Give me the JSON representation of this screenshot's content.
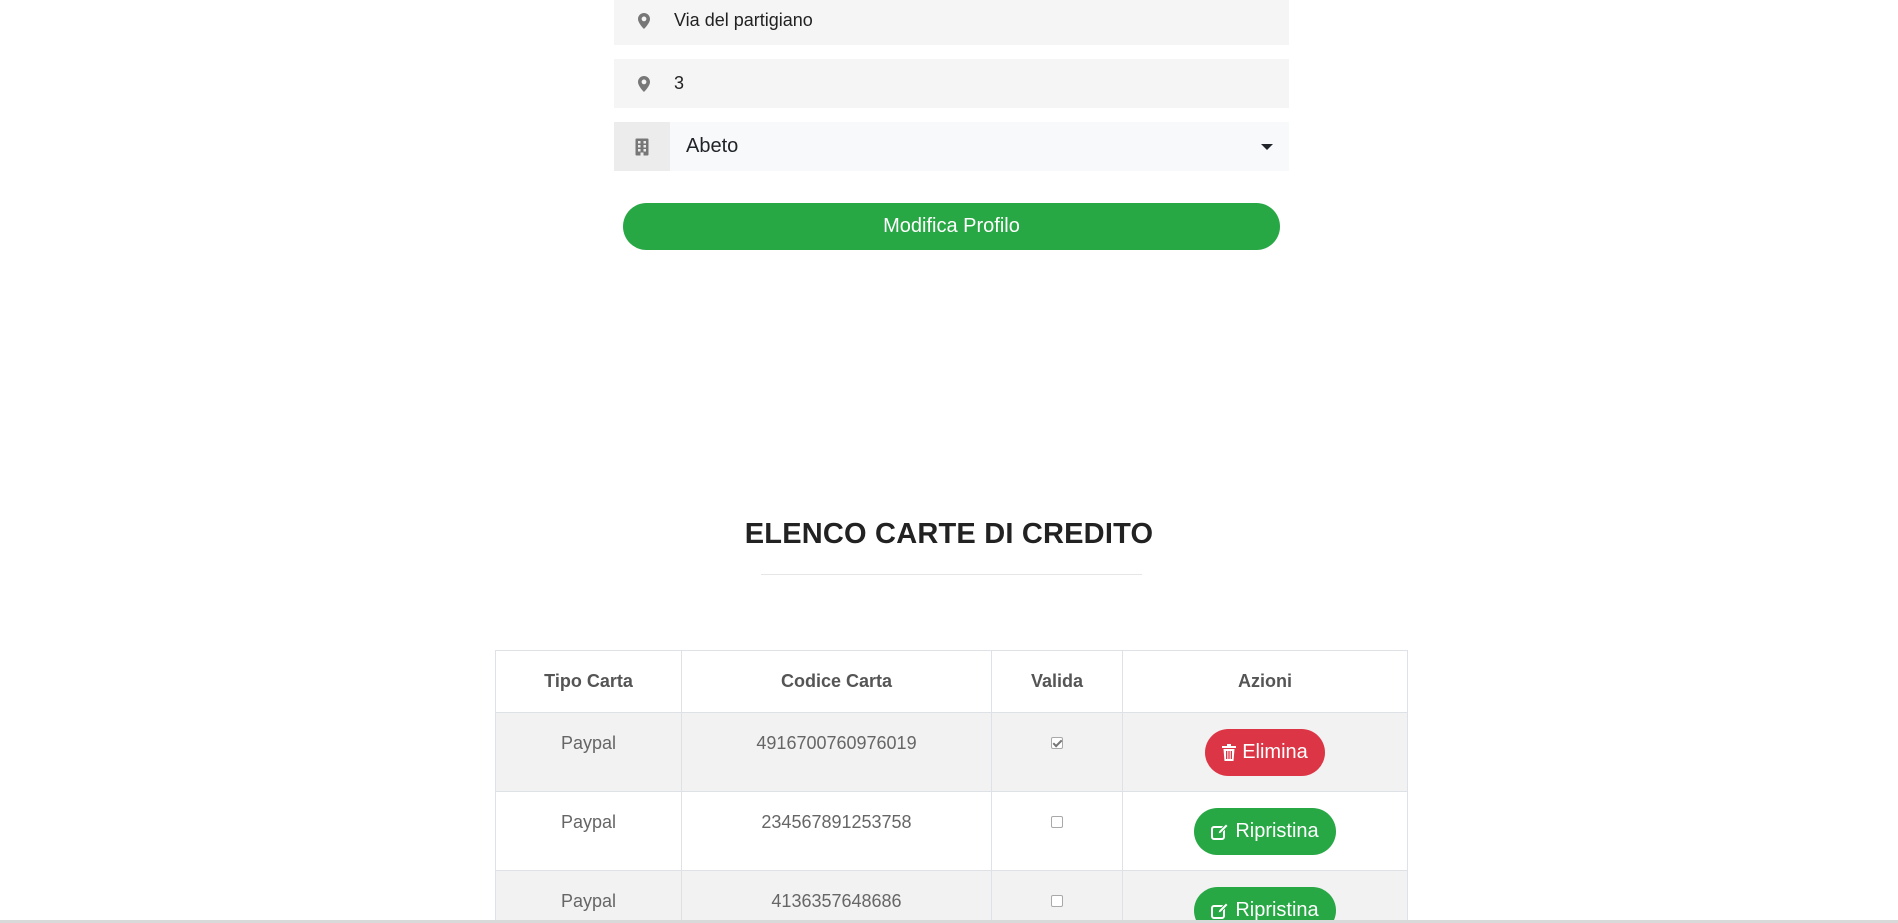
{
  "profile_form": {
    "street_value": "Via del partigiano",
    "street_icon": "map-marker-icon",
    "civic_value": "3",
    "civic_icon": "map-marker-icon",
    "city_selected": "Abeto",
    "city_icon": "building-icon",
    "submit_label": "Modifica Profilo",
    "submit_color": "#28a745"
  },
  "cards_section": {
    "title": "ELENCO CARTE DI CREDITO",
    "columns": [
      "Tipo Carta",
      "Codice Carta",
      "Valida",
      "Azioni"
    ],
    "rows": [
      {
        "type": "Paypal",
        "code": "4916700760976019",
        "valid": true,
        "action": "Elimina",
        "action_icon": "trash-icon",
        "action_color": "#dc3545"
      },
      {
        "type": "Paypal",
        "code": "234567891253758",
        "valid": false,
        "action": "Ripristina",
        "action_icon": "edit-icon",
        "action_color": "#28a745"
      },
      {
        "type": "Paypal",
        "code": "4136357648686",
        "valid": false,
        "action": "Ripristina",
        "action_icon": "edit-icon",
        "action_color": "#28a745"
      }
    ]
  }
}
